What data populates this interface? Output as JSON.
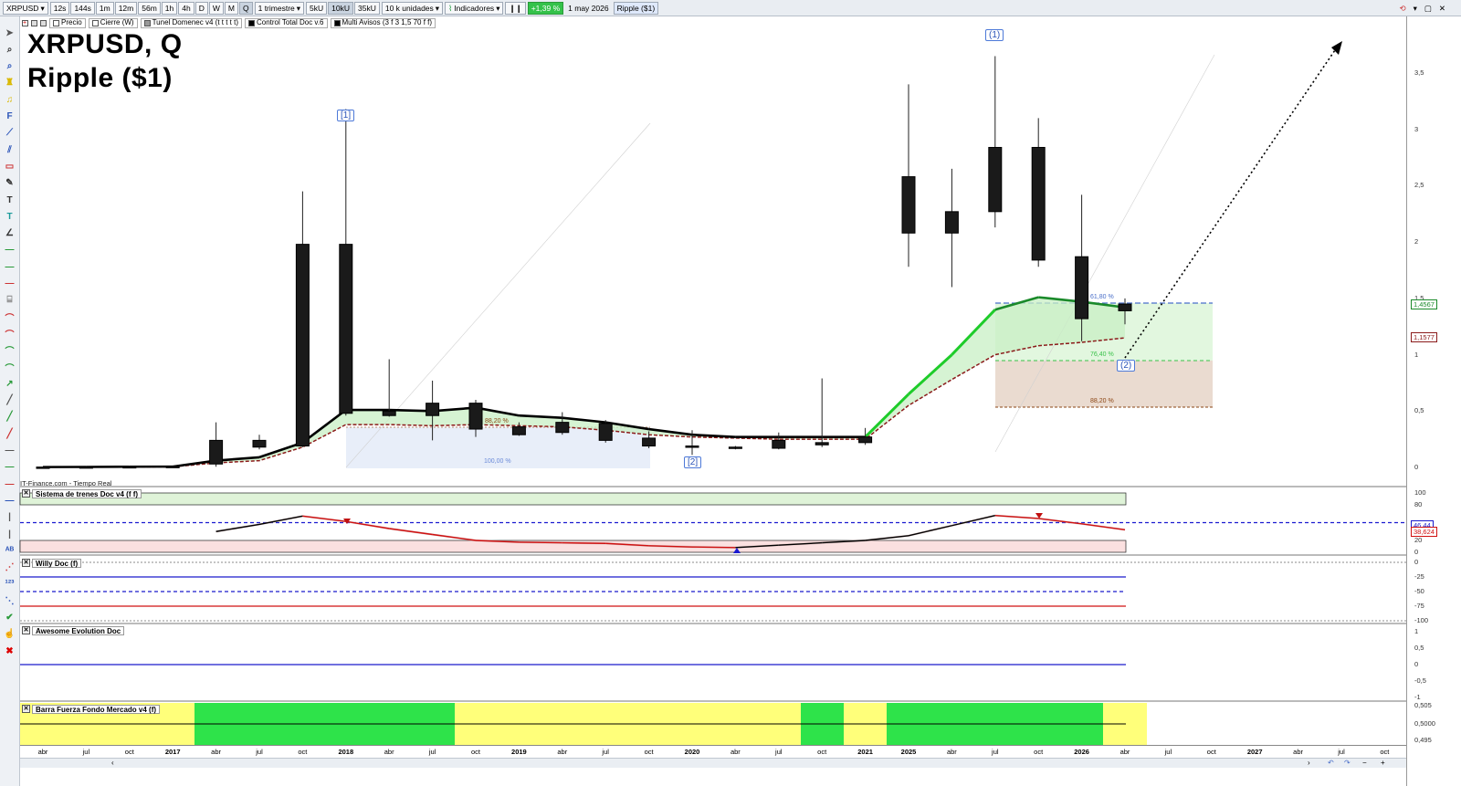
{
  "toolbar": {
    "symbol": "XRPUSD",
    "timeframes": [
      "12s",
      "144s",
      "1m",
      "12m",
      "56m",
      "1h",
      "4h",
      "D",
      "W",
      "M",
      "Q"
    ],
    "period": "1 trimestre",
    "units": [
      "5kU",
      "10kU",
      "35kU"
    ],
    "units_select": "10 k unidades",
    "indicators": "Indicadores",
    "change": "+1,39 %",
    "date": "1 may 2026",
    "name": "Ripple ($1)"
  },
  "legend": {
    "price": "Precio",
    "close": "Cierre (W)",
    "tunel": "Tunel Domenec v4 (t t t t t)",
    "control": "Control Total Doc v.6",
    "multi": "Multi Avisos (3 f 3 1,5 70 f f)"
  },
  "chart_title": {
    "line1": "XRPUSD, Q",
    "line2": "Ripple ($1)"
  },
  "source": "IT-Finance.com - Tiempo Real",
  "annotations": {
    "w1_upper": "(1)",
    "w2_upper": "(2)",
    "w1_lower": "[1]",
    "w2_lower": "[2]"
  },
  "fib_labels": {
    "f618": "61,80 %",
    "f764": "76,40 %",
    "f882": "88,20 %",
    "f882_left": "88,20 %",
    "f100": "100,00 %"
  },
  "price_axis": {
    "ticks": [
      "3,5",
      "3",
      "2,5",
      "2",
      "1,5",
      "1",
      "0,5",
      "0"
    ],
    "last_price": "1,4567",
    "level_2": "1,1577"
  },
  "panels": {
    "trenes": {
      "title": "Sistema de trenes Doc v4 (f f)",
      "ticks": [
        "100",
        "80",
        "50",
        "20",
        "0"
      ],
      "tags": [
        "46,44",
        "38,624"
      ]
    },
    "willy": {
      "title": "Willy Doc (f)",
      "ticks": [
        "0",
        "-25",
        "-50",
        "-75",
        "-100"
      ]
    },
    "awesome": {
      "title": "Awesome Evolution Doc",
      "ticks": [
        "1",
        "0,5",
        "0",
        "-0,5",
        "-1"
      ]
    },
    "barra": {
      "title": "Barra Fuerza Fondo Mercado v4 (f)",
      "ticks": [
        "0,505",
        "0,5000",
        "0,495"
      ]
    }
  },
  "time_axis": [
    {
      "label": "abr",
      "bold": false
    },
    {
      "label": "jul",
      "bold": false
    },
    {
      "label": "oct",
      "bold": false
    },
    {
      "label": "2017",
      "bold": true
    },
    {
      "label": "abr",
      "bold": false
    },
    {
      "label": "jul",
      "bold": false
    },
    {
      "label": "oct",
      "bold": false
    },
    {
      "label": "2018",
      "bold": true
    },
    {
      "label": "abr",
      "bold": false
    },
    {
      "label": "jul",
      "bold": false
    },
    {
      "label": "oct",
      "bold": false
    },
    {
      "label": "2019",
      "bold": true
    },
    {
      "label": "abr",
      "bold": false
    },
    {
      "label": "jul",
      "bold": false
    },
    {
      "label": "oct",
      "bold": false
    },
    {
      "label": "2020",
      "bold": true
    },
    {
      "label": "abr",
      "bold": false
    },
    {
      "label": "jul",
      "bold": false
    },
    {
      "label": "oct",
      "bold": false
    },
    {
      "label": "2021",
      "bold": true
    },
    {
      "label": "2025",
      "bold": true
    },
    {
      "label": "abr",
      "bold": false
    },
    {
      "label": "jul",
      "bold": false
    },
    {
      "label": "oct",
      "bold": false
    },
    {
      "label": "2026",
      "bold": true
    },
    {
      "label": "abr",
      "bold": false
    },
    {
      "label": "jul",
      "bold": false
    },
    {
      "label": "oct",
      "bold": false
    },
    {
      "label": "2027",
      "bold": true
    },
    {
      "label": "abr",
      "bold": false
    },
    {
      "label": "jul",
      "bold": false
    },
    {
      "label": "oct",
      "bold": false
    }
  ],
  "colors": {
    "bull_fill": "#ffffff",
    "bear_fill": "#1a1a1a",
    "tunel_up": "#1ecc2a",
    "tunel_line": "#000000",
    "support": "#8b1a1a",
    "cloud": "#c8efc4",
    "fib_green": "#e2f7df",
    "fib_brown": "#eadbd0",
    "fib_blue": "#e8eef9",
    "yellow": "#ffff7a",
    "green": "#2ee34a"
  },
  "chart_data": {
    "type": "candlestick",
    "candles": [
      {
        "o": 0.003,
        "h": 0.004,
        "l": 0.002,
        "c": 0.003
      },
      {
        "o": 0.004,
        "h": 0.005,
        "l": 0.003,
        "c": 0.005
      },
      {
        "o": 0.006,
        "h": 0.007,
        "l": 0.005,
        "c": 0.007
      },
      {
        "o": 0.009,
        "h": 0.01,
        "l": 0.007,
        "c": 0.007
      },
      {
        "o": 0.03,
        "h": 0.4,
        "l": 0.006,
        "c": 0.24
      },
      {
        "o": 0.18,
        "h": 0.29,
        "l": 0.16,
        "c": 0.24
      },
      {
        "o": 0.19,
        "h": 2.45,
        "l": 0.18,
        "c": 1.98
      },
      {
        "o": 0.48,
        "h": 3.18,
        "l": 0.46,
        "c": 1.98
      },
      {
        "o": 0.46,
        "h": 0.96,
        "l": 0.45,
        "c": 0.5
      },
      {
        "o": 0.46,
        "h": 0.77,
        "l": 0.24,
        "c": 0.57
      },
      {
        "o": 0.34,
        "h": 0.6,
        "l": 0.27,
        "c": 0.57
      },
      {
        "o": 0.36,
        "h": 0.4,
        "l": 0.28,
        "c": 0.29
      },
      {
        "o": 0.31,
        "h": 0.49,
        "l": 0.29,
        "c": 0.4
      },
      {
        "o": 0.24,
        "h": 0.42,
        "l": 0.22,
        "c": 0.39
      },
      {
        "o": 0.19,
        "h": 0.32,
        "l": 0.17,
        "c": 0.26
      },
      {
        "o": 0.18,
        "h": 0.33,
        "l": 0.11,
        "c": 0.19
      },
      {
        "o": 0.17,
        "h": 0.19,
        "l": 0.16,
        "c": 0.18
      },
      {
        "o": 0.17,
        "h": 0.31,
        "l": 0.16,
        "c": 0.24
      },
      {
        "o": 0.2,
        "h": 0.79,
        "l": 0.18,
        "c": 0.22
      },
      {
        "o": 0.22,
        "h": 0.35,
        "l": 0.2,
        "c": 0.27
      },
      {
        "o": 2.08,
        "h": 3.4,
        "l": 1.78,
        "c": 2.58
      },
      {
        "o": 2.08,
        "h": 2.65,
        "l": 1.6,
        "c": 2.27
      },
      {
        "o": 2.27,
        "h": 3.65,
        "l": 2.13,
        "c": 2.84
      },
      {
        "o": 1.84,
        "h": 3.1,
        "l": 1.78,
        "c": 2.84
      },
      {
        "o": 1.32,
        "h": 2.42,
        "l": 1.12,
        "c": 1.87
      },
      {
        "o": 1.39,
        "h": 1.5,
        "l": 1.27,
        "c": 1.45
      }
    ],
    "tunel": [
      0.003,
      0.004,
      0.006,
      0.007,
      0.06,
      0.09,
      0.22,
      0.51,
      0.51,
      0.5,
      0.53,
      0.46,
      0.44,
      0.4,
      0.34,
      0.29,
      0.27,
      0.27,
      0.27,
      0.27,
      0.65,
      1.0,
      1.4,
      1.51,
      1.47,
      1.42
    ],
    "support": [
      0.002,
      0.003,
      0.004,
      0.005,
      0.04,
      0.06,
      0.18,
      0.38,
      0.38,
      0.37,
      0.38,
      0.37,
      0.36,
      0.33,
      0.29,
      0.27,
      0.26,
      0.25,
      0.25,
      0.25,
      0.55,
      0.78,
      1.0,
      1.08,
      1.11,
      1.15
    ],
    "ylim": [
      0,
      3.8
    ],
    "trenes": [
      null,
      null,
      null,
      null,
      35,
      47,
      61,
      52,
      40,
      30,
      20,
      17,
      16,
      15,
      11,
      9,
      8,
      12,
      16,
      20,
      28,
      45,
      62,
      57,
      48,
      38
    ],
    "trenes_ylim": [
      0,
      100
    ]
  }
}
